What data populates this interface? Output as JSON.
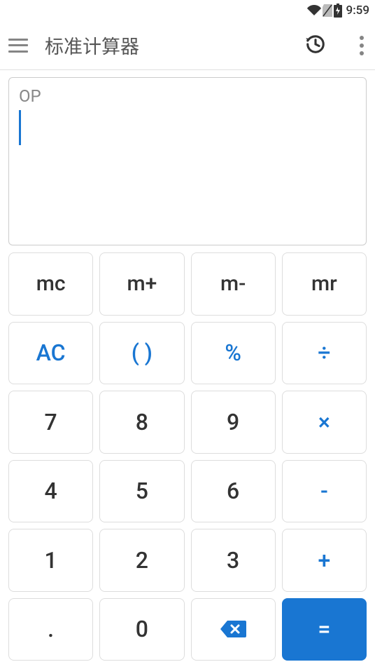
{
  "status": {
    "time": "9:59"
  },
  "appBar": {
    "title": "标准计算器"
  },
  "display": {
    "label": "OP",
    "value": ""
  },
  "keys": {
    "mc": "mc",
    "mplus": "m+",
    "mminus": "m-",
    "mr": "mr",
    "ac": "AC",
    "paren": "( )",
    "percent": "%",
    "divide": "÷",
    "k7": "7",
    "k8": "8",
    "k9": "9",
    "multiply": "×",
    "k4": "4",
    "k5": "5",
    "k6": "6",
    "minus": "-",
    "k1": "1",
    "k2": "2",
    "k3": "3",
    "plus": "+",
    "dot": ".",
    "k0": "0",
    "equals": "="
  }
}
